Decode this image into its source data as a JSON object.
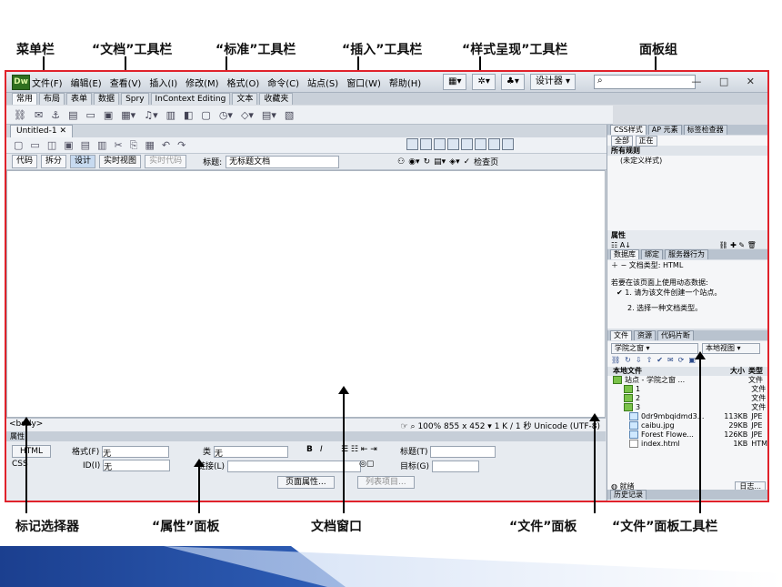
{
  "annotations": {
    "menu_bar": "菜单栏",
    "document_toolbar": "“文档”工具栏",
    "standard_toolbar": "“标准”工具栏",
    "insert_toolbar": "“插入”工具栏",
    "style_render_toolbar": "“样式呈现”工具栏",
    "panel_group": "面板组",
    "tag_selector": "标记选择器",
    "properties_panel": "“属性”面板",
    "document_window": "文档窗口",
    "files_panel": "“文件”面板",
    "files_panel_toolbar": "“文件”面板工具栏"
  },
  "app": {
    "logo": "Dw",
    "menu": [
      "文件(F)",
      "编辑(E)",
      "查看(V)",
      "插入(I)",
      "修改(M)",
      "格式(O)",
      "命令(C)",
      "站点(S)",
      "窗口(W)",
      "帮助(H)"
    ],
    "designer_label": "设计器 ▾",
    "window_controls": "— □ ✕"
  },
  "insert_tabs": [
    "常用",
    "布局",
    "表单",
    "数据",
    "Spry",
    "InContext Editing",
    "文本",
    "收藏夹"
  ],
  "document": {
    "tab_name": "Untitled-1",
    "view_buttons": [
      "代码",
      "拆分",
      "设计",
      "实时视图",
      "实时代码"
    ],
    "title_label": "标题:",
    "title_value": "无标题文档",
    "check_page": "检查页"
  },
  "status": {
    "tag": "<body>",
    "zoom": "100%",
    "info": "855 x 452 ▾ 1 K / 1 秒 Unicode (UTF-8)"
  },
  "properties": {
    "header": "属性",
    "html_btn": "HTML",
    "css_btn": "CSS",
    "format_label": "格式(F)",
    "format_value": "无",
    "id_label": "ID(I)",
    "id_value": "无",
    "class_label": "类",
    "class_value": "无",
    "link_label": "链接(L)",
    "title_label": "标题(T)",
    "target_label": "目标(G)",
    "page_props": "页面属性...",
    "list_item": "列表项目..."
  },
  "panels": {
    "css_tabs": [
      "CSS样式",
      "AP 元素",
      "标签检查器"
    ],
    "css_modes": [
      "全部",
      "正在"
    ],
    "all_rules": "所有规则",
    "undefined_style": "(未定义样式)",
    "attributes": "属性",
    "db_tabs": [
      "数据库",
      "绑定",
      "服务器行为"
    ],
    "doc_type": "文档类型: HTML",
    "dyn_text": "若要在该页面上使用动态数据:",
    "step1": "1. 请为该文件创建一个站点。",
    "step2": "2. 选择一种文档类型。",
    "files_tabs": [
      "文件",
      "资源",
      "代码片断"
    ],
    "site_name": "学院之窗",
    "view_name": "本地视图",
    "col_local": "本地文件",
    "col_size": "大小",
    "col_type": "类型",
    "files": [
      {
        "name": "站点 - 学院之窗 ...",
        "size": "",
        "type": "文件"
      },
      {
        "name": "1",
        "size": "",
        "type": "文件"
      },
      {
        "name": "2",
        "size": "",
        "type": "文件"
      },
      {
        "name": "3",
        "size": "",
        "type": "文件"
      },
      {
        "name": "0dr9mbqidmd3...",
        "size": "113KB",
        "type": "JPE"
      },
      {
        "name": "caibu.jpg",
        "size": "29KB",
        "type": "JPE"
      },
      {
        "name": "Forest Flowe...",
        "size": "126KB",
        "type": "JPE"
      },
      {
        "name": "index.html",
        "size": "1KB",
        "type": "HTM"
      }
    ],
    "ready": "就绪",
    "log": "日志...",
    "history": "历史记录"
  }
}
